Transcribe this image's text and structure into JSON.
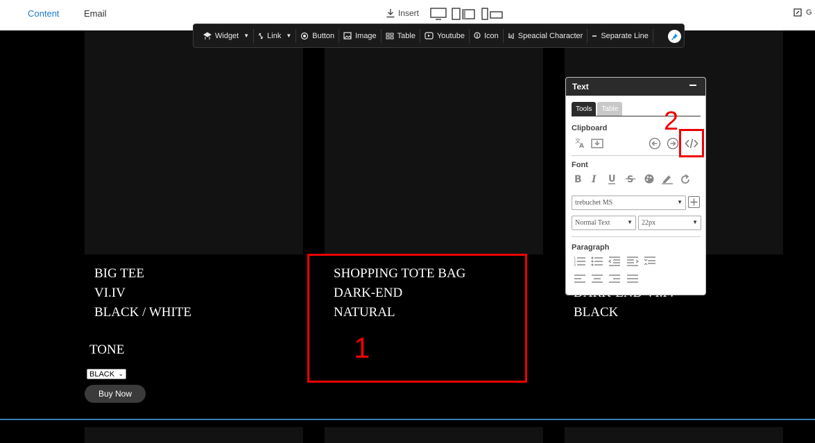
{
  "topbar": {
    "tabs": [
      "Content",
      "Email"
    ],
    "insert_label": "Insert",
    "right_label": "G"
  },
  "insert_toolbar": {
    "items": [
      {
        "label": "Widget",
        "icon": "widget-icon",
        "dropdown": true
      },
      {
        "label": "Link",
        "icon": "link-icon",
        "dropdown": true
      },
      {
        "label": "Button",
        "icon": "radio-button-icon"
      },
      {
        "label": "Image",
        "icon": "image-icon"
      },
      {
        "label": "Table",
        "icon": "table-icon"
      },
      {
        "label": "Youtube",
        "icon": "youtube-icon"
      },
      {
        "label": "Icon",
        "icon": "icon-icon"
      },
      {
        "label": "Speacial Character",
        "icon": "omega-icon"
      },
      {
        "label": "Separate Line",
        "icon": "minus-icon"
      }
    ]
  },
  "products": [
    {
      "lines": [
        "BIG TEE",
        "VI.IV",
        "BLACK / WHITE"
      ]
    },
    {
      "lines": [
        "SHOPPING TOTE BAG",
        "DARK-END",
        "NATURAL"
      ]
    },
    {
      "lines": [
        "DARK-END VI.IV",
        "BLACK"
      ]
    }
  ],
  "product_options": {
    "tone_label": "TONE",
    "select_value": "BLACK",
    "buy_label": "Buy Now"
  },
  "annotations": {
    "box1_label": "1",
    "box2_label": "2",
    "color": "#e00000"
  },
  "text_panel": {
    "title": "Text",
    "tabs": [
      "Tools",
      "Table"
    ],
    "sections": {
      "clipboard": "Clipboard",
      "font": "Font",
      "paragraph": "Paragraph"
    },
    "font_family": "trebuchet MS",
    "text_style": "Normal Text",
    "font_size": "22px"
  },
  "colors": {
    "accent_tab": "#1b79c6",
    "divider": "#3a7fb5"
  }
}
